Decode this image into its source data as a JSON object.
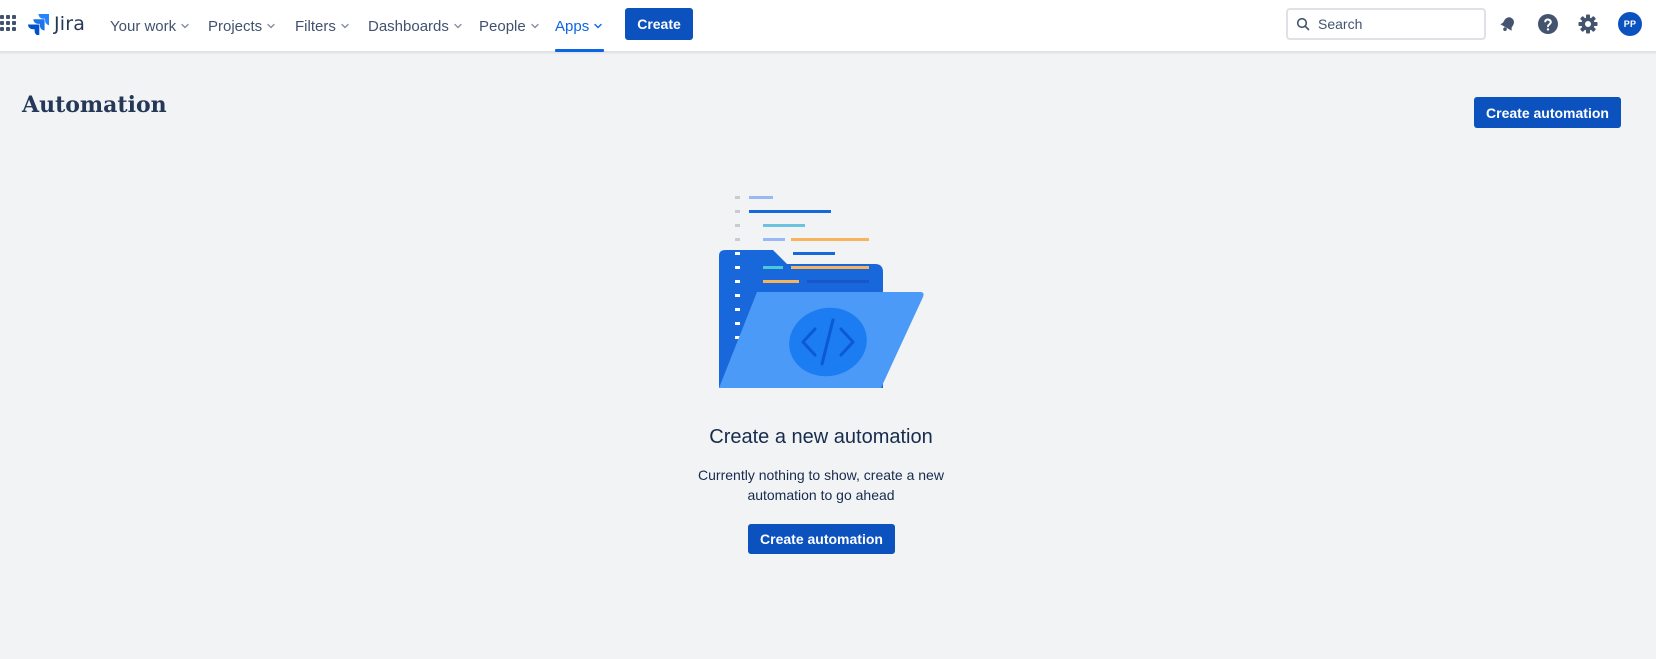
{
  "brand": {
    "product_name": "Jira"
  },
  "nav": {
    "your_work": "Your work",
    "projects": "Projects",
    "filters": "Filters",
    "dashboards": "Dashboards",
    "people": "People",
    "apps": "Apps",
    "create": "Create",
    "active": "Apps"
  },
  "search": {
    "placeholder": "Search"
  },
  "icons": {
    "app_switcher": "app-switcher-grid-icon",
    "notifications": "bell-icon",
    "help": "help-icon",
    "settings": "gear-icon",
    "search": "search-icon"
  },
  "user": {
    "initials": "PP"
  },
  "page": {
    "title": "Automation",
    "create_button": "Create automation"
  },
  "empty_state": {
    "title": "Create a new automation",
    "description": "Currently nothing to show, create a new automation to go ahead",
    "button": "Create automation"
  },
  "colors": {
    "primary": "#0c52bf",
    "active_nav": "#0c66e4",
    "background": "#f2f3f5"
  }
}
